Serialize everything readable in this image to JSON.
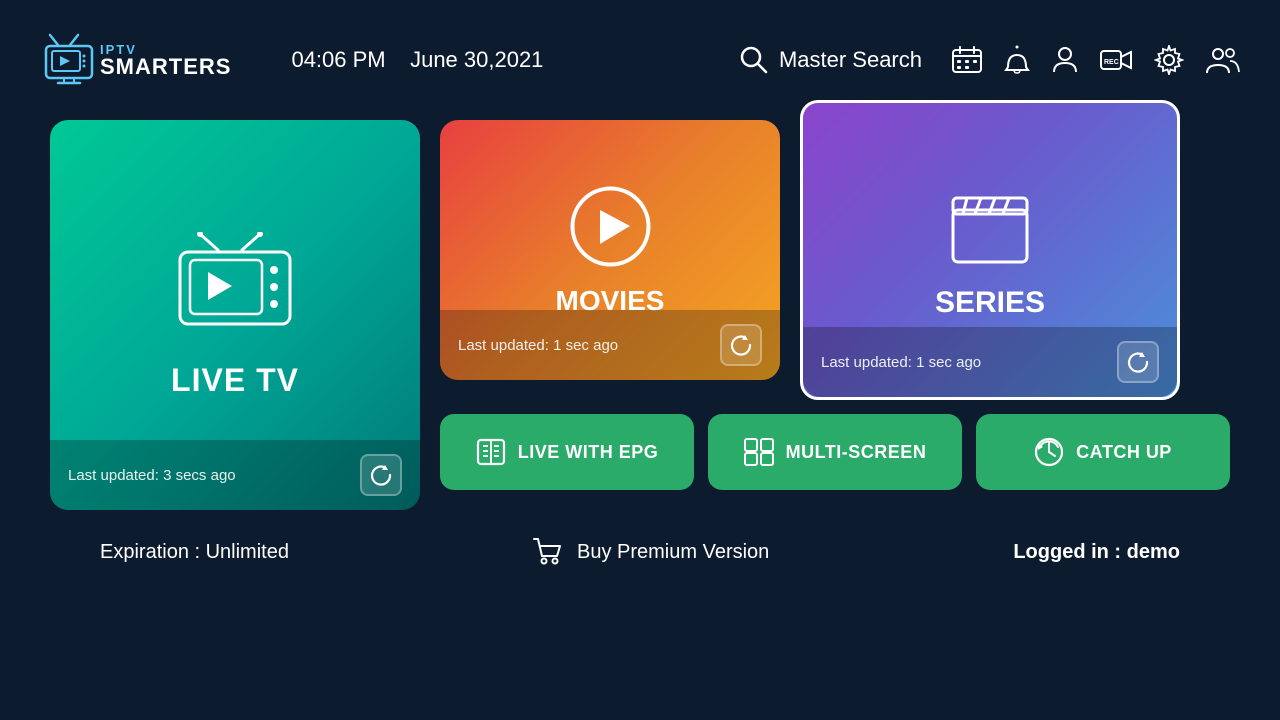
{
  "logo": {
    "iptv": "IPTV",
    "smarters": "SMARTERS"
  },
  "header": {
    "time": "04:06 PM",
    "date": "June 30,2021",
    "search_label": "Master Search"
  },
  "cards": {
    "live_tv": {
      "label": "LIVE TV",
      "last_updated": "Last updated: 3 secs ago"
    },
    "movies": {
      "label": "MOVIES",
      "last_updated": "Last updated: 1 sec ago"
    },
    "series": {
      "label": "SERIES",
      "last_updated": "Last updated: 1 sec ago"
    }
  },
  "buttons": {
    "live_epg": "LIVE WITH EPG",
    "multi_screen": "MULTI-SCREEN",
    "catch_up": "CATCH UP"
  },
  "footer": {
    "expiry_label": "Expiration : Unlimited",
    "buy_label": "Buy Premium Version",
    "logged_prefix": "Logged in : ",
    "logged_user": "demo"
  }
}
